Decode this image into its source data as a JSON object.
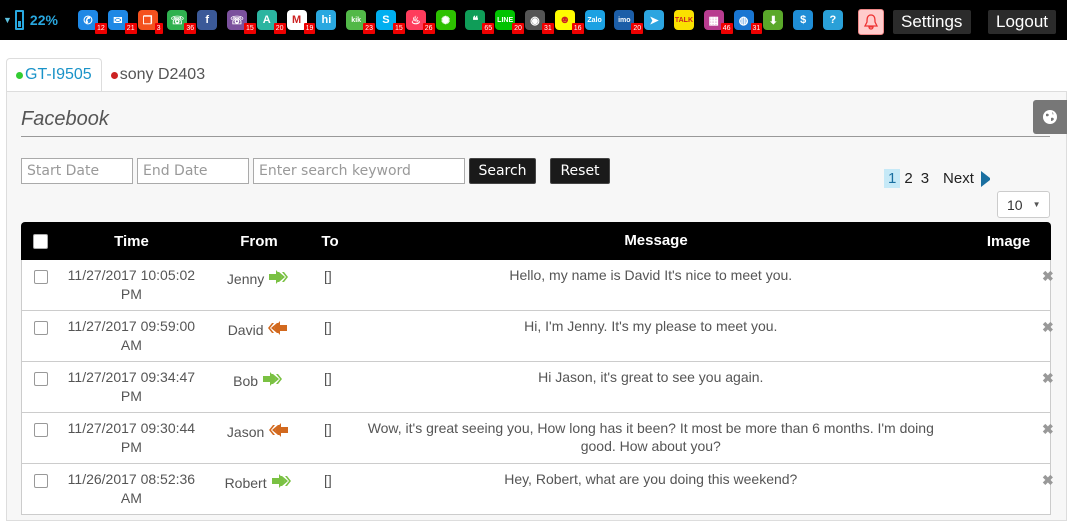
{
  "status": {
    "battery": "22%"
  },
  "apps": [
    {
      "icon": "phone-icon",
      "color": "#1e88e5",
      "glyph": "✆",
      "count": "12"
    },
    {
      "icon": "mail-icon",
      "color": "#1e88e5",
      "glyph": "✉",
      "count": "21"
    },
    {
      "icon": "copy-icon",
      "color": "#f4511e",
      "glyph": "❐",
      "count": "3"
    },
    {
      "icon": "whatsapp-icon",
      "color": "#2fb14f",
      "glyph": "☏",
      "count": "36"
    },
    {
      "icon": "facebook-icon",
      "color": "#3b5998",
      "glyph": "f",
      "count": ""
    },
    {
      "icon": "viber-icon",
      "color": "#7b519d",
      "glyph": "☏",
      "count": "15"
    },
    {
      "icon": "a-app-icon",
      "color": "#2bb5a0",
      "glyph": "A",
      "count": "20"
    },
    {
      "icon": "gmail-icon",
      "color": "#ffffff",
      "glyph": "M",
      "count": "19"
    },
    {
      "icon": "hi-icon",
      "color": "#2aa8e0",
      "glyph": "hi",
      "count": ""
    },
    {
      "icon": "kik-icon",
      "color": "#52b848",
      "glyph": "kik",
      "count": "23"
    },
    {
      "icon": "skype-icon",
      "color": "#00aff0",
      "glyph": "S",
      "count": "15"
    },
    {
      "icon": "tinder-icon",
      "color": "#fe3c5c",
      "glyph": "♨",
      "count": "26"
    },
    {
      "icon": "wechat-icon",
      "color": "#2dc100",
      "glyph": "✺",
      "count": ""
    },
    {
      "icon": "hangouts-icon",
      "color": "#0f9d58",
      "glyph": "❝",
      "count": "65"
    },
    {
      "icon": "line-icon",
      "color": "#00c300",
      "glyph": "LINE",
      "count": "20"
    },
    {
      "icon": "instagram-icon",
      "color": "#555555",
      "glyph": "◉",
      "count": "31"
    },
    {
      "icon": "snapchat-icon",
      "color": "#fffc00",
      "glyph": "☻",
      "count": "16"
    },
    {
      "icon": "zalo-icon",
      "color": "#1ba1e2",
      "glyph": "Zalo",
      "count": ""
    },
    {
      "icon": "imo-icon",
      "color": "#1c5ea8",
      "glyph": "imo",
      "count": "20"
    },
    {
      "icon": "telegram-icon",
      "color": "#2ca5e0",
      "glyph": "➤",
      "count": ""
    },
    {
      "icon": "kakaotalk-icon",
      "color": "#fae100",
      "glyph": "TALK",
      "count": ""
    },
    {
      "icon": "gallery-icon",
      "color": "#b83c8f",
      "glyph": "▦",
      "count": "46"
    },
    {
      "icon": "browser-icon",
      "color": "#1976d2",
      "glyph": "◍",
      "count": "31"
    },
    {
      "icon": "download-icon",
      "color": "#5aa82a",
      "glyph": "⬇",
      "count": ""
    },
    {
      "icon": "dollar-icon",
      "color": "#1f8dd6",
      "glyph": "$",
      "count": ""
    },
    {
      "icon": "help-icon",
      "color": "#2aa0d8",
      "glyph": "?",
      "count": ""
    }
  ],
  "nav": {
    "settings": "Settings",
    "logout": "Logout"
  },
  "devices": [
    {
      "name": "GT-I9505",
      "status": "online"
    },
    {
      "name": "sony D2403",
      "status": "offline"
    }
  ],
  "page": {
    "title": "Facebook"
  },
  "filters": {
    "start_placeholder": "Start Date",
    "end_placeholder": "End Date",
    "keyword_placeholder": "Enter search keyword",
    "search": "Search",
    "reset": "Reset"
  },
  "pagination": {
    "pages": [
      "1",
      "2",
      "3"
    ],
    "current": "1",
    "next": "Next",
    "page_size": "10"
  },
  "table": {
    "headers": {
      "time": "Time",
      "from": "From",
      "to": "To",
      "message": "Message",
      "image": "Image"
    },
    "rows": [
      {
        "time": "11/27/2017 10:05:02 PM",
        "from": "Jenny",
        "direction": "incoming",
        "to": "[]",
        "message": "Hello, my name is David It's nice to meet you."
      },
      {
        "time": "11/27/2017 09:59:00 AM",
        "from": "David",
        "direction": "outgoing",
        "to": "[]",
        "message": "Hi, I'm Jenny. It's my please to meet you."
      },
      {
        "time": "11/27/2017 09:34:47 PM",
        "from": "Bob",
        "direction": "incoming",
        "to": "[]",
        "message": "Hi Jason, it's great to see you again."
      },
      {
        "time": "11/27/2017 09:30:44 PM",
        "from": "Jason",
        "direction": "outgoing",
        "to": "[]",
        "message": "Wow, it's great seeing you, How long has it been? It most be more than 6 months. I'm doing good. How about you?"
      },
      {
        "time": "11/26/2017 08:52:36 AM",
        "from": "Robert",
        "direction": "incoming",
        "to": "[]",
        "message": "Hey, Robert, what are you doing this weekend?"
      }
    ]
  },
  "colors": {
    "incoming_arrow": "#7ac143",
    "outgoing_arrow": "#d2691e",
    "accent": "#1a93c8"
  }
}
